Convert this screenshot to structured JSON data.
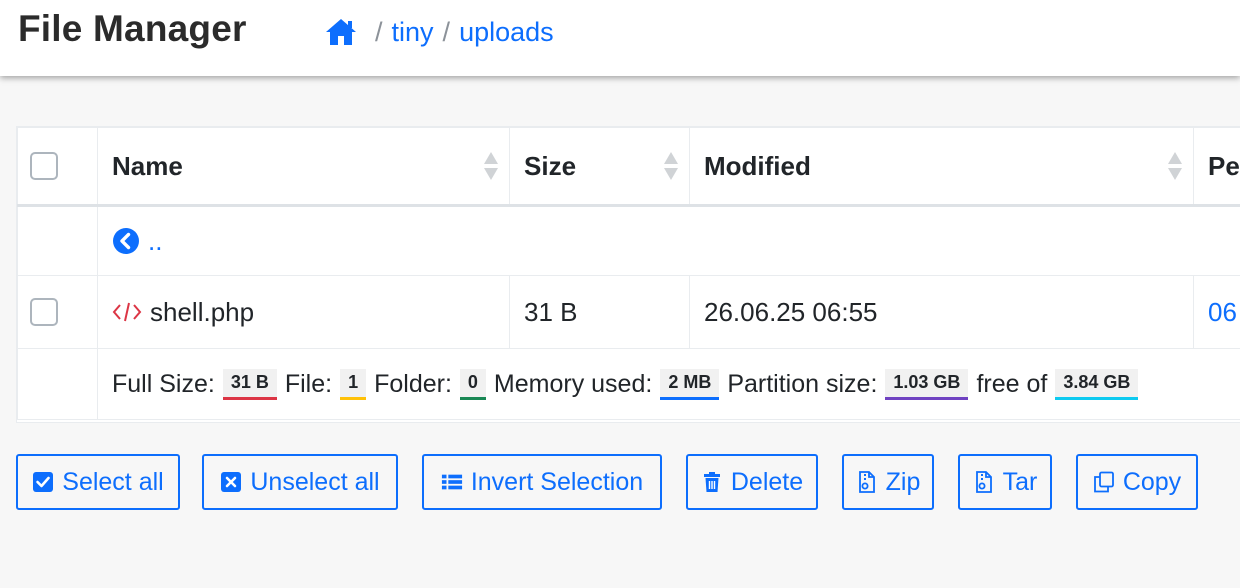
{
  "app": {
    "title": "File Manager"
  },
  "breadcrumb": {
    "items": [
      "tiny",
      "uploads"
    ],
    "separator": "/"
  },
  "table": {
    "headers": {
      "name": "Name",
      "size": "Size",
      "modified": "Modified",
      "perms": "Pe"
    },
    "up_link": "..",
    "files": [
      {
        "name": "shell.php",
        "size": "31 B",
        "modified": "26.06.25 06:55",
        "perms": "06"
      }
    ],
    "footer": {
      "full_size_label": "Full Size:",
      "full_size": "31 B",
      "file_label": "File:",
      "file_count": "1",
      "folder_label": "Folder:",
      "folder_count": "0",
      "memory_label": "Memory used:",
      "memory": "2 MB",
      "partition_label": "Partition size:",
      "partition": "1.03 GB",
      "free_label": "free of",
      "free_total": "3.84 GB"
    }
  },
  "actions": {
    "select_all": "Select all",
    "unselect_all": "Unselect all",
    "invert": "Invert Selection",
    "delete": "Delete",
    "zip": "Zip",
    "tar": "Tar",
    "copy": "Copy"
  },
  "colors": {
    "link": "#0d6efd",
    "badge_full": "#dc3545",
    "badge_file": "#ffc107",
    "badge_folder": "#198754",
    "badge_memory": "#0d6efd",
    "badge_partition": "#6f42c1",
    "badge_free": "#0dcaf0",
    "php_icon": "#dc3545"
  },
  "icons": {
    "home": "home-icon",
    "back": "circle-chevron-left-icon",
    "code": "code-icon",
    "sort": "sort-icon",
    "check": "check-square-icon",
    "unselect": "x-square-icon",
    "list": "list-icon",
    "trash": "trash-icon",
    "zip": "zip-file-icon",
    "tar": "tar-file-icon",
    "copy": "copy-icon"
  }
}
